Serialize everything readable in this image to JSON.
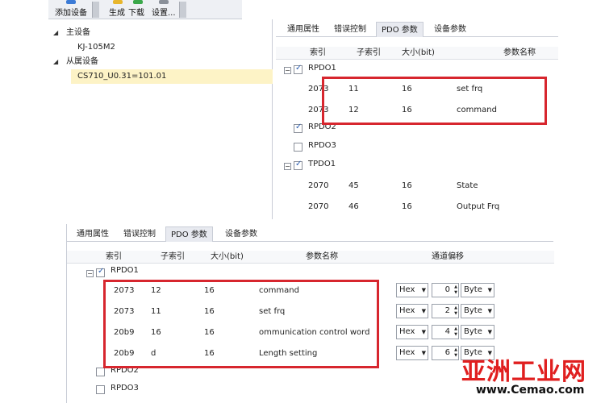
{
  "toolbar": {
    "add_device": "添加设备",
    "generate": "生成",
    "download": "下载",
    "settings": "设置..."
  },
  "tree": {
    "master_label": "主设备",
    "master_child": "KJ-105M2",
    "slave_label": "从属设备",
    "slave_child": "CS710_U0.31=101.01"
  },
  "top_panel": {
    "tabs": [
      "通用属性",
      "错误控制",
      "PDO 参数",
      "设备参数"
    ],
    "columns": {
      "index": "索引",
      "subindex": "子索引",
      "size": "大小(bit)",
      "param_name": "参数名称"
    },
    "groups": [
      {
        "label": "RPDO1",
        "checked": true,
        "rows": [
          {
            "index": "2073",
            "sub": "11",
            "size": "16",
            "name": "set frq"
          },
          {
            "index": "2073",
            "sub": "12",
            "size": "16",
            "name": "command"
          }
        ]
      },
      {
        "label": "RPDO2",
        "checked": true,
        "rows": []
      },
      {
        "label": "RPDO3",
        "checked": false,
        "rows": []
      },
      {
        "label": "TPDO1",
        "checked": true,
        "rows": [
          {
            "index": "2070",
            "sub": "45",
            "size": "16",
            "name": "State"
          },
          {
            "index": "2070",
            "sub": "46",
            "size": "16",
            "name": "Output Frq"
          }
        ]
      }
    ]
  },
  "bottom_panel": {
    "tabs": [
      "通用属性",
      "错误控制",
      "PDO 参数",
      "设备参数"
    ],
    "columns": {
      "index": "索引",
      "subindex": "子索引",
      "size": "大小(bit)",
      "param_name": "参数名称",
      "channel_offset": "通道偏移"
    },
    "group_rpdo1": "RPDO1",
    "group_rpdo2": "RPDO2",
    "group_rpdo3": "RPDO3",
    "rows": [
      {
        "index": "2073",
        "sub": "12",
        "size": "16",
        "name": "command",
        "type": "Hex",
        "offset": "0",
        "unit": "Byte"
      },
      {
        "index": "2073",
        "sub": "11",
        "size": "16",
        "name": "set frq",
        "type": "Hex",
        "offset": "2",
        "unit": "Byte"
      },
      {
        "index": "20b9",
        "sub": "16",
        "size": "16",
        "name": "ommunication control word",
        "type": "Hex",
        "offset": "4",
        "unit": "Byte"
      },
      {
        "index": "20b9",
        "sub": "d",
        "size": "16",
        "name": "Length setting",
        "type": "Hex",
        "offset": "6",
        "unit": "Byte"
      }
    ]
  },
  "watermark": {
    "brand": "亚洲工业网",
    "url": "www.Cemao.com"
  },
  "colors": {
    "highlight": "#d7262e",
    "selected_row": "#fdf3c6",
    "watermark": "#e01f1f"
  }
}
